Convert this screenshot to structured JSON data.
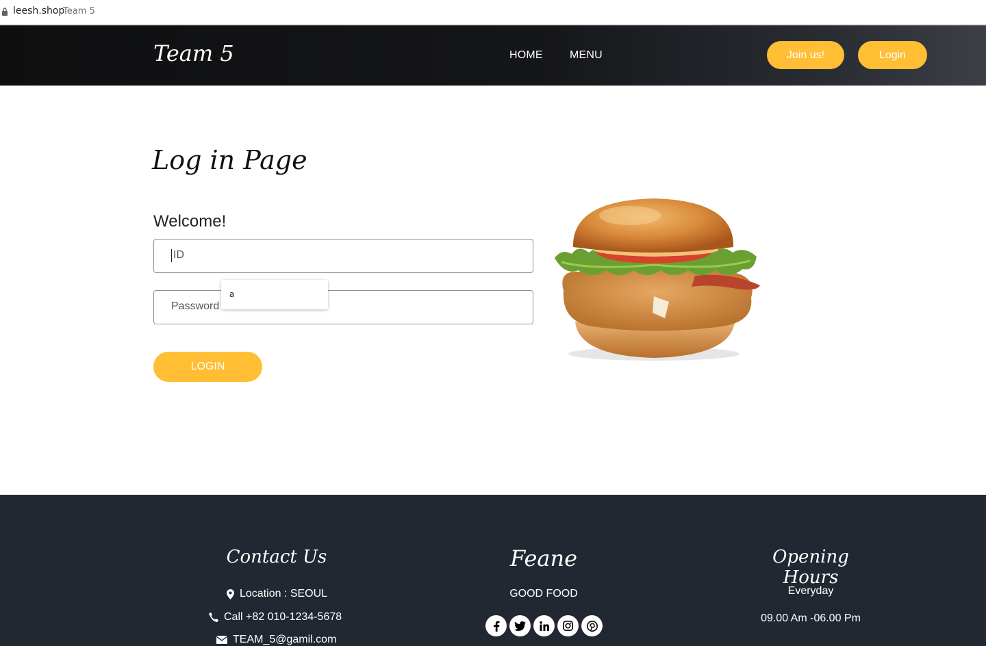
{
  "browser": {
    "domain": "leesh.shop",
    "tab_title": "Team 5"
  },
  "header": {
    "brand": "Team 5",
    "nav": [
      {
        "label": "HOME"
      },
      {
        "label": "MENU"
      }
    ],
    "join_label": "Join us!",
    "login_label": "Login",
    "accent_color": "#ffbe33"
  },
  "main": {
    "title": "Log in Page",
    "welcome": "Welcome!",
    "id_placeholder": "ID",
    "password_placeholder": "Password",
    "autocomplete_suggestion": "a",
    "submit_label": "LOGIN",
    "image": "burger-image"
  },
  "footer": {
    "contact_heading": "Contact Us",
    "location": "Location : SEOUL",
    "call": "Call +82 010-1234-5678",
    "email": "TEAM_5@gamil.com",
    "brand_heading": "Feane",
    "tagline": "GOOD FOOD",
    "social_icons": [
      "facebook-icon",
      "twitter-icon",
      "linkedin-icon",
      "instagram-icon",
      "pinterest-icon"
    ],
    "hours_heading": "Opening Hours",
    "hours_days": "Everyday",
    "hours_time": "09.00 Am -06.00 Pm",
    "background_color": "#222831"
  }
}
